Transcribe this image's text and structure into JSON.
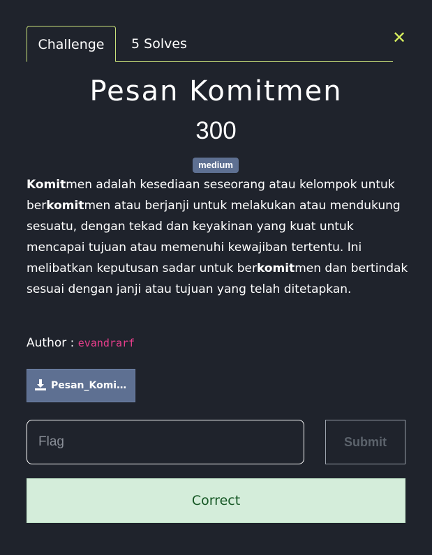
{
  "tabs": [
    {
      "label": "Challenge"
    },
    {
      "label": "5 Solves"
    }
  ],
  "close": {
    "icon": "close-icon",
    "color": "#d7ef5e"
  },
  "challenge": {
    "title": "Pesan Komitmen",
    "points": "300",
    "difficulty": "medium",
    "description": [
      {
        "text": "Komit",
        "bold": true
      },
      {
        "text": "men adalah kesediaan seseorang atau kelompok untuk ber",
        "bold": false
      },
      {
        "text": "komit",
        "bold": true
      },
      {
        "text": "men atau berjanji untuk melakukan atau mendukung sesuatu, dengan tekad dan keyakinan yang kuat untuk mencapai tujuan atau memenuhi kewajiban tertentu. Ini melibatkan keputusan sadar untuk ber",
        "bold": false
      },
      {
        "text": "komit",
        "bold": true
      },
      {
        "text": "men dan bertindak sesuai dengan janji atau tujuan yang telah ditetapkan.",
        "bold": false
      }
    ],
    "author_label": "Author :",
    "author_name": "evandrarf",
    "file_label": "Pesan_Komit..."
  },
  "form": {
    "flag_placeholder": "Flag",
    "flag_value": "",
    "submit_label": "Submit"
  },
  "result": {
    "message": "Correct"
  },
  "colors": {
    "background": "#1f232c",
    "accent": "#c8e07a",
    "badge": "#5e7092",
    "author": "#e83e8c",
    "success_bg": "#d4edda",
    "success_text": "#155724"
  }
}
